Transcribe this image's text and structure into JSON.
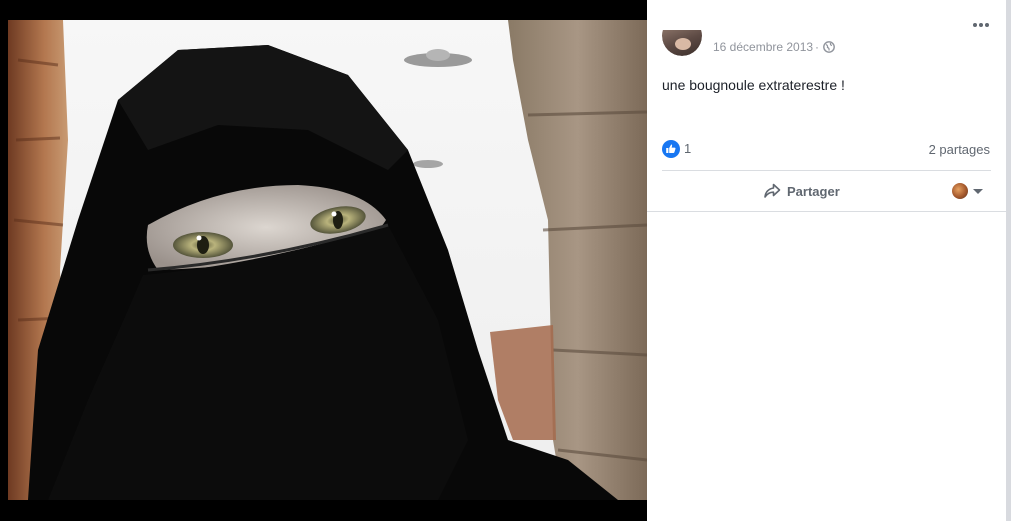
{
  "post": {
    "date": "16 décembre 2013",
    "date_separator": "·",
    "privacy_icon": "globe-icon",
    "text": "une bougnoule extraterestre !",
    "more_icon": "more-options-icon"
  },
  "reactions": {
    "like_icon": "like-icon",
    "like_count": "1",
    "shares": "2 partages"
  },
  "actions": {
    "share_label": "Partager",
    "share_icon": "share-arrow-icon",
    "audience_caret_icon": "caret-down-icon"
  },
  "colors": {
    "like_blue": "#1877f2",
    "secondary_text": "#606770",
    "meta_text": "#90949c",
    "body_text": "#1d2129",
    "divider": "#dadde1"
  }
}
